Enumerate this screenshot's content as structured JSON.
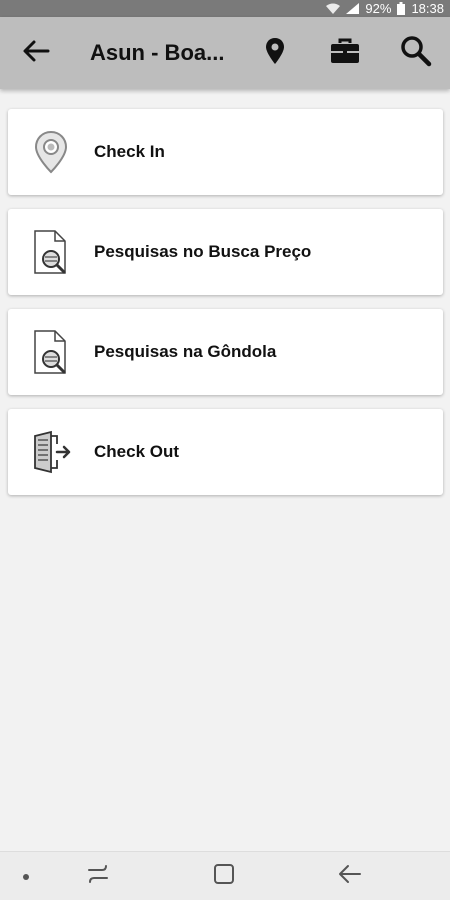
{
  "status_bar": {
    "battery": "92%",
    "time": "18:38"
  },
  "app_bar": {
    "title": "Asun - Boa...",
    "back_icon": "arrow-left-icon",
    "actions": [
      "location-pin-icon",
      "briefcase-icon",
      "search-icon"
    ]
  },
  "menu": {
    "items": [
      {
        "label": "Check In",
        "icon": "location-pin-icon"
      },
      {
        "label": "Pesquisas no Busca Preço",
        "icon": "document-search-icon"
      },
      {
        "label": "Pesquisas na Gôndola",
        "icon": "document-search-icon"
      },
      {
        "label": "Check Out",
        "icon": "exit-door-icon"
      }
    ]
  },
  "nav_bar": {
    "buttons": [
      "recent-apps-icon",
      "home-icon",
      "back-icon"
    ]
  },
  "colors": {
    "status_bar": "#7a7a7a",
    "app_bar": "#bdbdbd",
    "background": "#f2f2f2",
    "card": "#ffffff",
    "text": "#111111"
  }
}
